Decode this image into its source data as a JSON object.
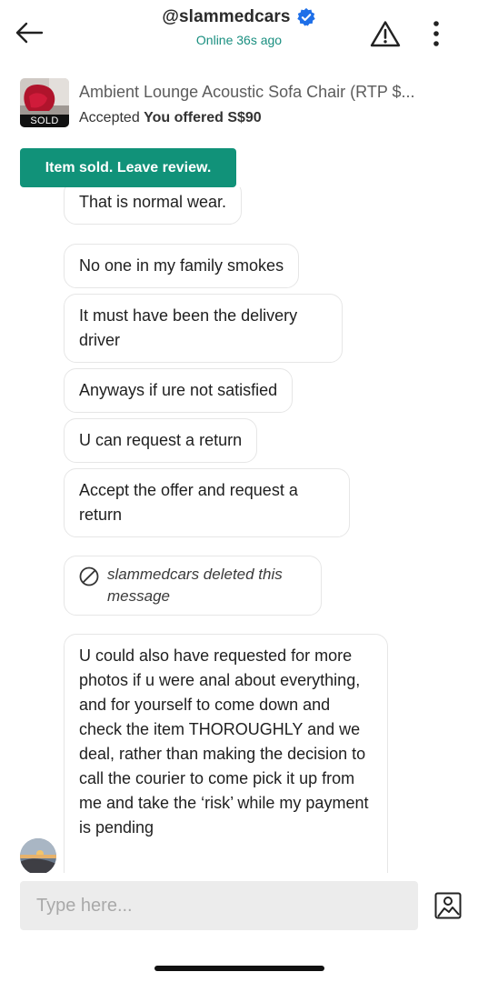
{
  "header": {
    "username": "@slammedcars",
    "status": "Online 36s ago",
    "icons": {
      "back": "arrow-left-icon",
      "verified": "verified-badge-icon",
      "report": "warning-triangle-icon",
      "more": "more-vertical-icon"
    }
  },
  "listing": {
    "title": "Ambient Lounge Acoustic Sofa Chair (RTP $...",
    "status_prefix": "Accepted",
    "offer_text": "You offered S$90",
    "sold_label": "SOLD"
  },
  "review_button": {
    "label": "Item sold. Leave review."
  },
  "messages": [
    {
      "text": "That is normal wear."
    },
    {
      "text": "No one in my family smokes"
    },
    {
      "text": "It must have been the delivery driver"
    },
    {
      "text": "Anyways if ure not satisfied"
    },
    {
      "text": "U can request a return"
    },
    {
      "text": "Accept the offer and request a return"
    },
    {
      "text": "slammedcars deleted this message",
      "deleted": true
    },
    {
      "text": "U could also have requested for more photos if u were anal about everything, and for yourself to come down and check the item THOROUGHLY and we deal, rather than making the decision to call the courier to come pick it up from me and take the ‘risk’ while my payment is pending"
    }
  ],
  "composer": {
    "placeholder": "Type here..."
  },
  "colors": {
    "accent": "#119279",
    "online": "#1a8f80",
    "verified": "#1e6fe8"
  }
}
